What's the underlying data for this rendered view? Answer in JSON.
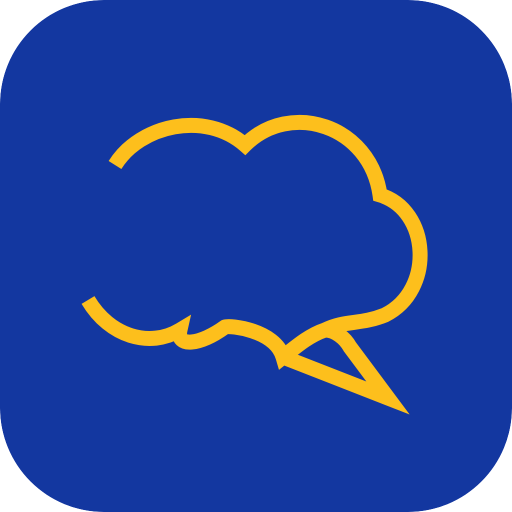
{
  "icon": {
    "kind": "chat-cloud-app-icon",
    "colors": {
      "background": "#1337A0",
      "stroke": "#FDBF1C"
    }
  }
}
